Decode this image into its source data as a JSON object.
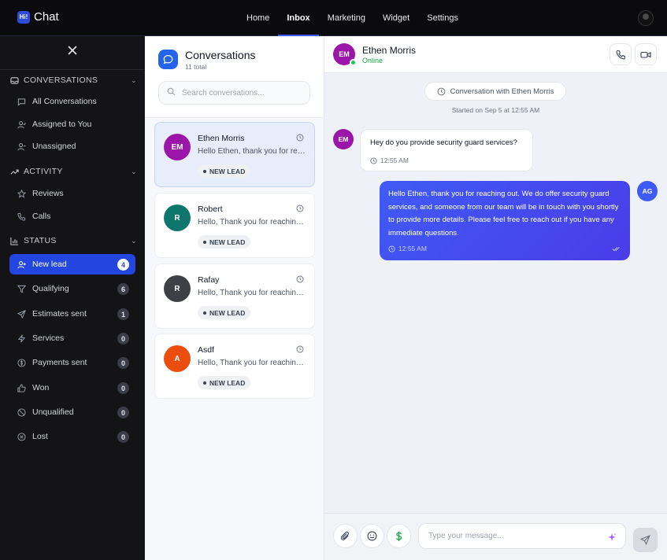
{
  "app": {
    "logo_mark": "Hi!",
    "name": "Chat"
  },
  "topnav": [
    {
      "label": "Home"
    },
    {
      "label": "Inbox",
      "active": true
    },
    {
      "label": "Marketing"
    },
    {
      "label": "Widget"
    },
    {
      "label": "Settings"
    }
  ],
  "sidebar": {
    "conversations_heading": "CONVERSATIONS",
    "conversations_items": [
      {
        "label": "All Conversations",
        "icon": "message-square-icon"
      },
      {
        "label": "Assigned to You",
        "icon": "user-check-icon"
      },
      {
        "label": "Unassigned",
        "icon": "user-minus-icon"
      }
    ],
    "activity_heading": "ACTIVITY",
    "activity_items": [
      {
        "label": "Reviews",
        "icon": "star-icon"
      },
      {
        "label": "Calls",
        "icon": "phone-icon"
      }
    ],
    "status_heading": "STATUS",
    "status_items": [
      {
        "label": "New lead",
        "count": "4",
        "icon": "user-plus-icon",
        "active": true
      },
      {
        "label": "Qualifying",
        "count": "6",
        "icon": "filter-icon"
      },
      {
        "label": "Estimates sent",
        "count": "1",
        "icon": "send-icon"
      },
      {
        "label": "Services",
        "count": "0",
        "icon": "zap-icon"
      },
      {
        "label": "Payments sent",
        "count": "0",
        "icon": "dollar-circle-icon"
      },
      {
        "label": "Won",
        "count": "0",
        "icon": "thumbs-up-icon"
      },
      {
        "label": "Unqualified",
        "count": "0",
        "icon": "ban-icon"
      },
      {
        "label": "Lost",
        "count": "0",
        "icon": "x-circle-icon"
      }
    ]
  },
  "conversations": {
    "title": "Conversations",
    "total": "11 total",
    "search_placeholder": "Search conversations...",
    "items": [
      {
        "initials": "EM",
        "name": "Ethen Morris",
        "preview": "Hello Ethen, thank you for reaching out.",
        "tag": "NEW LEAD",
        "color": "#9b16a8",
        "selected": true
      },
      {
        "initials": "R",
        "name": "Robert",
        "preview": "Hello, Thank you for reaching out.",
        "tag": "NEW LEAD",
        "color": "#0f766e"
      },
      {
        "initials": "R",
        "name": "Rafay",
        "preview": "Hello, Thank you for reaching out.",
        "tag": "NEW LEAD",
        "color": "#3f3f46"
      },
      {
        "initials": "A",
        "name": "Asdf",
        "preview": "Hello, Thank you for reaching out.",
        "tag": "NEW LEAD",
        "color": "#ea4d0c"
      }
    ]
  },
  "chat": {
    "contact_initials": "EM",
    "contact_name": "Ethen Morris",
    "contact_status": "Online",
    "pill_text": "Conversation with Ethen Morris",
    "started_text": "Started on Sep 5 at 12:55 AM",
    "incoming": {
      "initials": "EM",
      "text": "Hey do you provide security guard services?",
      "time": "12:55 AM"
    },
    "outgoing": {
      "initials": "AG",
      "text": "Hello Ethen, thank you for reaching out. We do offer security guard services, and someone from our team will be in touch with you shortly to provide more details. Please feel free to reach out if you have any immediate questions.",
      "time": "12:55 AM"
    },
    "input_placeholder": "Type your message..."
  },
  "colors": {
    "accent": "#2346e0",
    "online": "#22c55e",
    "outgoing_gradient_start": "#3f5bf6",
    "outgoing_gradient_end": "#4a3ce8"
  }
}
